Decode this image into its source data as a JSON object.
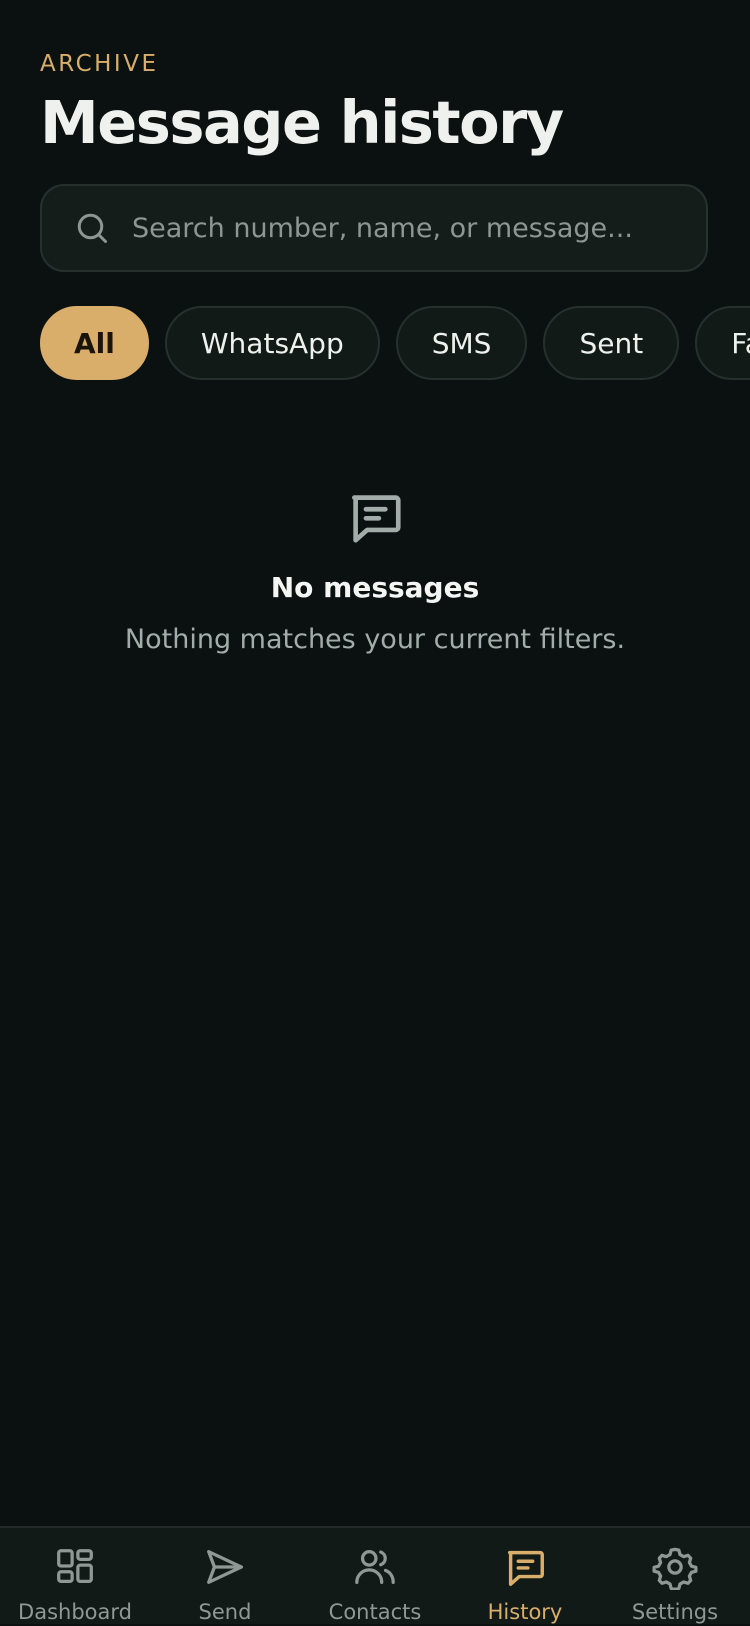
{
  "header": {
    "eyebrow": "ARCHIVE",
    "title": "Message history"
  },
  "search": {
    "placeholder": "Search number, name, or message...",
    "value": "",
    "icon": "search-icon"
  },
  "filters": {
    "selected": "All",
    "chips": [
      {
        "label": "All",
        "active": true
      },
      {
        "label": "WhatsApp",
        "active": false
      },
      {
        "label": "SMS",
        "active": false
      },
      {
        "label": "Sent",
        "active": false
      },
      {
        "label": "Failed",
        "active": false
      }
    ]
  },
  "empty_state": {
    "icon": "message-icon",
    "title": "No messages",
    "subtitle": "Nothing matches your current filters."
  },
  "bottom_nav": {
    "active": "History",
    "items": [
      {
        "label": "Dashboard",
        "icon": "dashboard-icon"
      },
      {
        "label": "Send",
        "icon": "send-icon"
      },
      {
        "label": "Contacts",
        "icon": "contacts-icon"
      },
      {
        "label": "History",
        "icon": "message-icon"
      },
      {
        "label": "Settings",
        "icon": "gear-icon"
      }
    ]
  },
  "colors": {
    "background": "#0b1110",
    "accent": "#d9ad6a",
    "surface": "#151d1b",
    "muted_text": "#8c9692"
  }
}
